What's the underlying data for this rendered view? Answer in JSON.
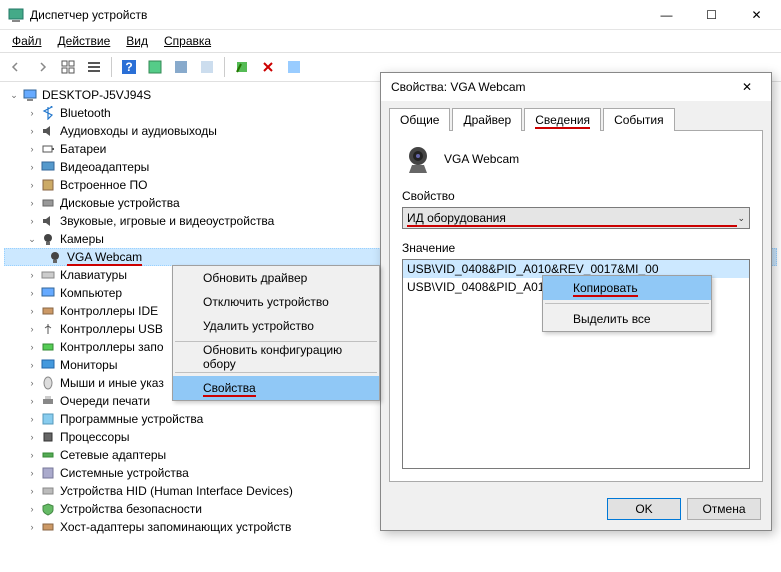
{
  "window": {
    "title": "Диспетчер устройств"
  },
  "menu": {
    "file": "Файл",
    "action": "Действие",
    "view": "Вид",
    "help": "Справка"
  },
  "tree": {
    "root": "DESKTOP-J5VJ94S",
    "items": [
      "Bluetooth",
      "Аудиовходы и аудиовыходы",
      "Батареи",
      "Видеоадаптеры",
      "Встроенное ПО",
      "Дисковые устройства",
      "Звуковые, игровые и видеоустройства",
      "Камеры",
      "Клавиатуры",
      "Компьютер",
      "Контроллеры IDE",
      "Контроллеры USB",
      "Контроллеры запо",
      "Мониторы",
      "Мыши и иные указ",
      "Очереди печати",
      "Программные устройства",
      "Процессоры",
      "Сетевые адаптеры",
      "Системные устройства",
      "Устройства HID (Human Interface Devices)",
      "Устройства безопасности",
      "Хост-адаптеры запоминающих устройств"
    ],
    "camera_child": "VGA Webcam"
  },
  "context": {
    "update_driver": "Обновить драйвер",
    "disable": "Отключить устройство",
    "uninstall": "Удалить устройство",
    "scan": "Обновить конфигурацию обору",
    "properties": "Свойства"
  },
  "dialog": {
    "title": "Свойства: VGA Webcam",
    "tabs": {
      "general": "Общие",
      "driver": "Драйвер",
      "details": "Сведения",
      "events": "События"
    },
    "device_name": "VGA Webcam",
    "property_label": "Свойство",
    "combo_value": "ИД оборудования",
    "value_label": "Значение",
    "values": [
      "USB\\VID_0408&PID_A010&REV_0017&MI_00",
      "USB\\VID_0408&PID_A010"
    ],
    "ok": "OK",
    "cancel": "Отмена"
  },
  "small_menu": {
    "copy": "Копировать",
    "select_all": "Выделить все"
  }
}
